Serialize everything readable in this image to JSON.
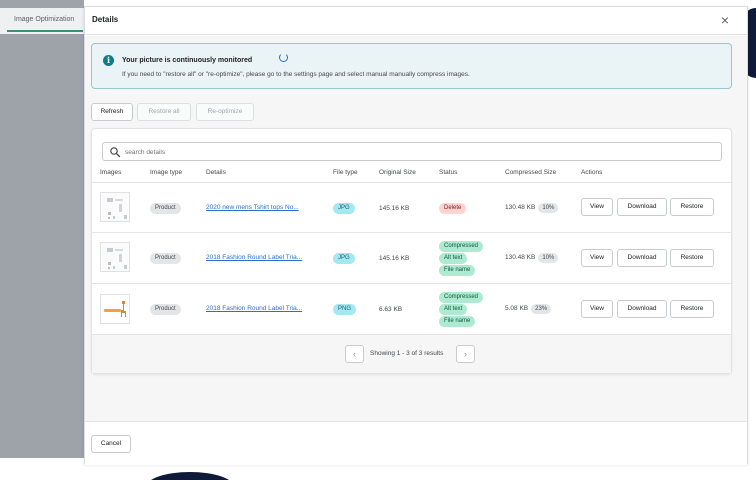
{
  "app": {
    "nav_tab": "Image Optimization"
  },
  "modal": {
    "title": "Details",
    "close_symbol": "×"
  },
  "banner": {
    "title": "Your picture is continuously monitored",
    "text": "If you need to \"restore all\" or \"re-optimize\", please go to the settings page and select manual manually compress images."
  },
  "toolbar": {
    "refresh": "Refresh",
    "restore_all": "Restore all",
    "reoptimize": "Re-optimize"
  },
  "search": {
    "placeholder": "search details"
  },
  "table": {
    "headers": [
      "Images",
      "Image type",
      "Details",
      "File type",
      "Original Size",
      "Status",
      "Compressed Size",
      "Actions"
    ],
    "rows": [
      {
        "image_type": "Product",
        "details": "2020 new mens Tshirt tops No...",
        "file_type": "JPG",
        "original_size": "145.16 KB",
        "status": [
          "Delete"
        ],
        "compressed_size": "130.48 KB",
        "percent": "10%"
      },
      {
        "image_type": "Product",
        "details": "2018 Fashion Round Label Tria...",
        "file_type": "JPG",
        "original_size": "145.16 KB",
        "status": [
          "Compressed",
          "Alt text",
          "File name"
        ],
        "compressed_size": "130.48 KB",
        "percent": "10%"
      },
      {
        "image_type": "Product",
        "details": "2018 Fashion Round Label Tria...",
        "file_type": "PNG",
        "original_size": "6.63 KB",
        "status": [
          "Compressed",
          "Alt text",
          "File name"
        ],
        "compressed_size": "5.08 KB",
        "percent": "23%"
      }
    ],
    "actions": {
      "view": "View",
      "download": "Download",
      "restore": "Restore"
    }
  },
  "pagination": {
    "text": "Showing 1 - 3 of 3 results",
    "prev": "‹",
    "next": "›"
  },
  "footer": {
    "cancel": "Cancel"
  }
}
